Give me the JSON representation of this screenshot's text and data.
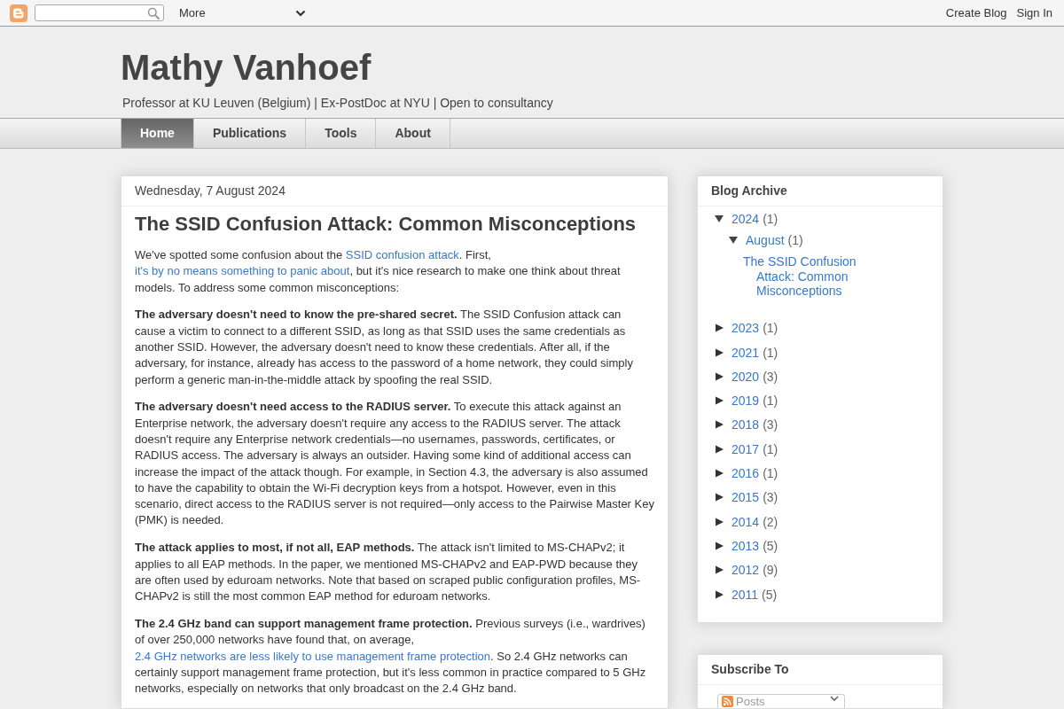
{
  "navbar": {
    "more_menu": "More",
    "links": [
      "Create Blog",
      "Sign In"
    ]
  },
  "header": {
    "title": "Mathy Vanhoef",
    "description": "Professor at KU Leuven (Belgium) | Ex-PostDoc at NYU | Open to consultancy"
  },
  "tabs": [
    {
      "label": "Home",
      "selected": true
    },
    {
      "label": "Publications",
      "selected": false
    },
    {
      "label": "Tools",
      "selected": false
    },
    {
      "label": "About",
      "selected": false
    }
  ],
  "post": {
    "date": "Wednesday, 7 August 2024",
    "title": "The SSID Confusion Attack: Common Misconceptions",
    "paragraphs": [
      [
        {
          "kind": "text",
          "text": "We've spotted some confusion about the "
        },
        {
          "kind": "link",
          "text": "SSID confusion attack"
        },
        {
          "kind": "text",
          "text": ". First, "
        },
        {
          "kind": "link",
          "text": "it's by no means something to panic about"
        },
        {
          "kind": "text",
          "text": ", but it's nice research to make one think about threat models. To address some common misconceptions:"
        }
      ],
      [
        {
          "kind": "text",
          "text": "**The adversary doesn't need to know the pre-shared secret.** The SSID Confusion attack can cause a victim to connect to a different SSID, as long as that SSID uses the same credentials as another SSID. However, the adversary doesn't need to know these credentials. After all, if the adversary, for instance, already has access to the password of a home network, they could simply perform a generic man-in-the-middle attack by spoofing the real SSID."
        }
      ],
      [
        {
          "kind": "text",
          "text": "**The adversary doesn't need access to the RADIUS server.** To execute this attack against an Enterprise network, the adversary doesn't require any access to the RADIUS server. The attack doesn't require any Enterprise network credentials—no usernames, passwords, certificates, or RADIUS access. The adversary is always an outsider. Having some kind of additional access can increase the impact of the attack though. For example, in Section 4.3, the adversary is also assumed to have the capability to obtain the Wi-Fi decryption keys from a hotspot. However, even in this scenario, direct access to the RADIUS server is not required—only access to the Pairwise Master Key (PMK) is needed."
        }
      ],
      [
        {
          "kind": "text",
          "text": "**The attack applies to most, if not all, EAP methods.** The attack isn't limited to MS-CHAPv2; it applies to all EAP methods. In the paper, we mentioned MS-CHAPv2 and EAP-PWD because they are often used by eduroam networks. Note that based on scraped public configuration profiles, MS-CHAPv2 is still the most common EAP method for eduroam networks."
        }
      ],
      [
        {
          "kind": "text",
          "text": "**The 2.4 GHz band can support management frame protection.** Previous surveys (i.e., wardrives) of over 250,000 networks have found that, on average, "
        },
        {
          "kind": "link",
          "text": "2.4 GHz networks are less likely to use management frame protection"
        },
        {
          "kind": "text",
          "text": ". So 2.4 GHz networks can certainly support management frame protection, but it's less common in practice compared to 5 GHz networks, especially on networks that only broadcast on the 2.4 GHz band."
        }
      ]
    ]
  },
  "sidebar": {
    "archive": {
      "title": "Blog Archive",
      "items": [
        {
          "label": "2024",
          "count": "(1)",
          "expanded": true,
          "children": [
            {
              "label": "August",
              "count": "(1)",
              "expanded": true,
              "children": [
                {
                  "label": "The SSID Confusion Attack: Common Misconceptions"
                }
              ]
            }
          ]
        },
        {
          "label": "2023",
          "count": "(1)",
          "expanded": false
        },
        {
          "label": "2021",
          "count": "(1)",
          "expanded": false
        },
        {
          "label": "2020",
          "count": "(3)",
          "expanded": false
        },
        {
          "label": "2019",
          "count": "(1)",
          "expanded": false
        },
        {
          "label": "2018",
          "count": "(3)",
          "expanded": false
        },
        {
          "label": "2017",
          "count": "(1)",
          "expanded": false
        },
        {
          "label": "2016",
          "count": "(1)",
          "expanded": false
        },
        {
          "label": "2015",
          "count": "(3)",
          "expanded": false
        },
        {
          "label": "2014",
          "count": "(2)",
          "expanded": false
        },
        {
          "label": "2013",
          "count": "(5)",
          "expanded": false
        },
        {
          "label": "2012",
          "count": "(9)",
          "expanded": false
        },
        {
          "label": "2011",
          "count": "(5)",
          "expanded": false
        }
      ]
    },
    "subscribe": {
      "title": "Subscribe To",
      "dropdown": "Posts"
    }
  }
}
